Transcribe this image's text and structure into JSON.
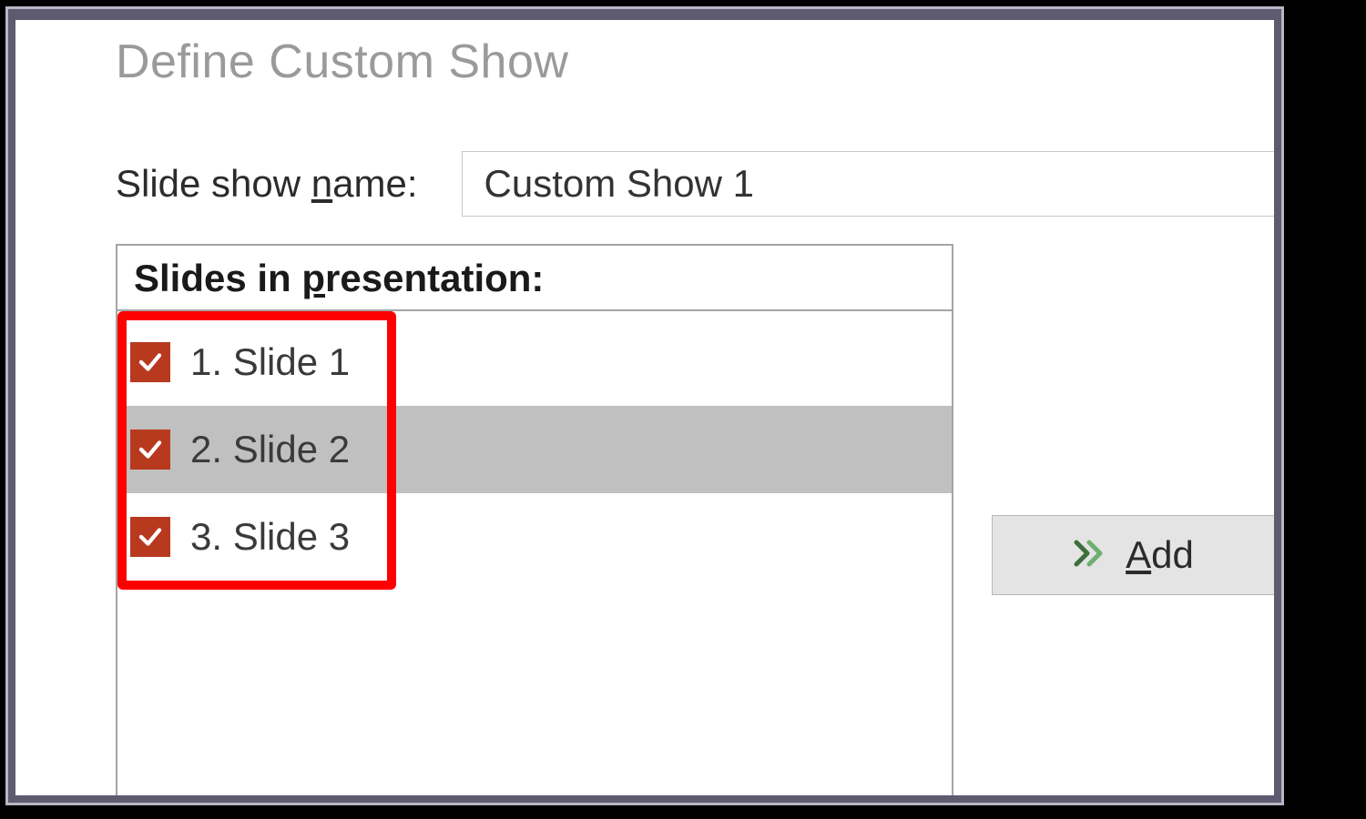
{
  "dialog": {
    "title": "Define Custom Show",
    "name_label_pre": "Slide show ",
    "name_label_u": "n",
    "name_label_post": "ame:",
    "name_value": "Custom Show 1",
    "list_header_pre": "Slides in ",
    "list_header_u": "p",
    "list_header_post": "resentation:",
    "slides": [
      {
        "label": "1. Slide 1",
        "checked": true,
        "selected": false
      },
      {
        "label": "2. Slide 2",
        "checked": true,
        "selected": true
      },
      {
        "label": "3. Slide 3",
        "checked": true,
        "selected": false
      }
    ],
    "add_u": "A",
    "add_post": "dd"
  }
}
